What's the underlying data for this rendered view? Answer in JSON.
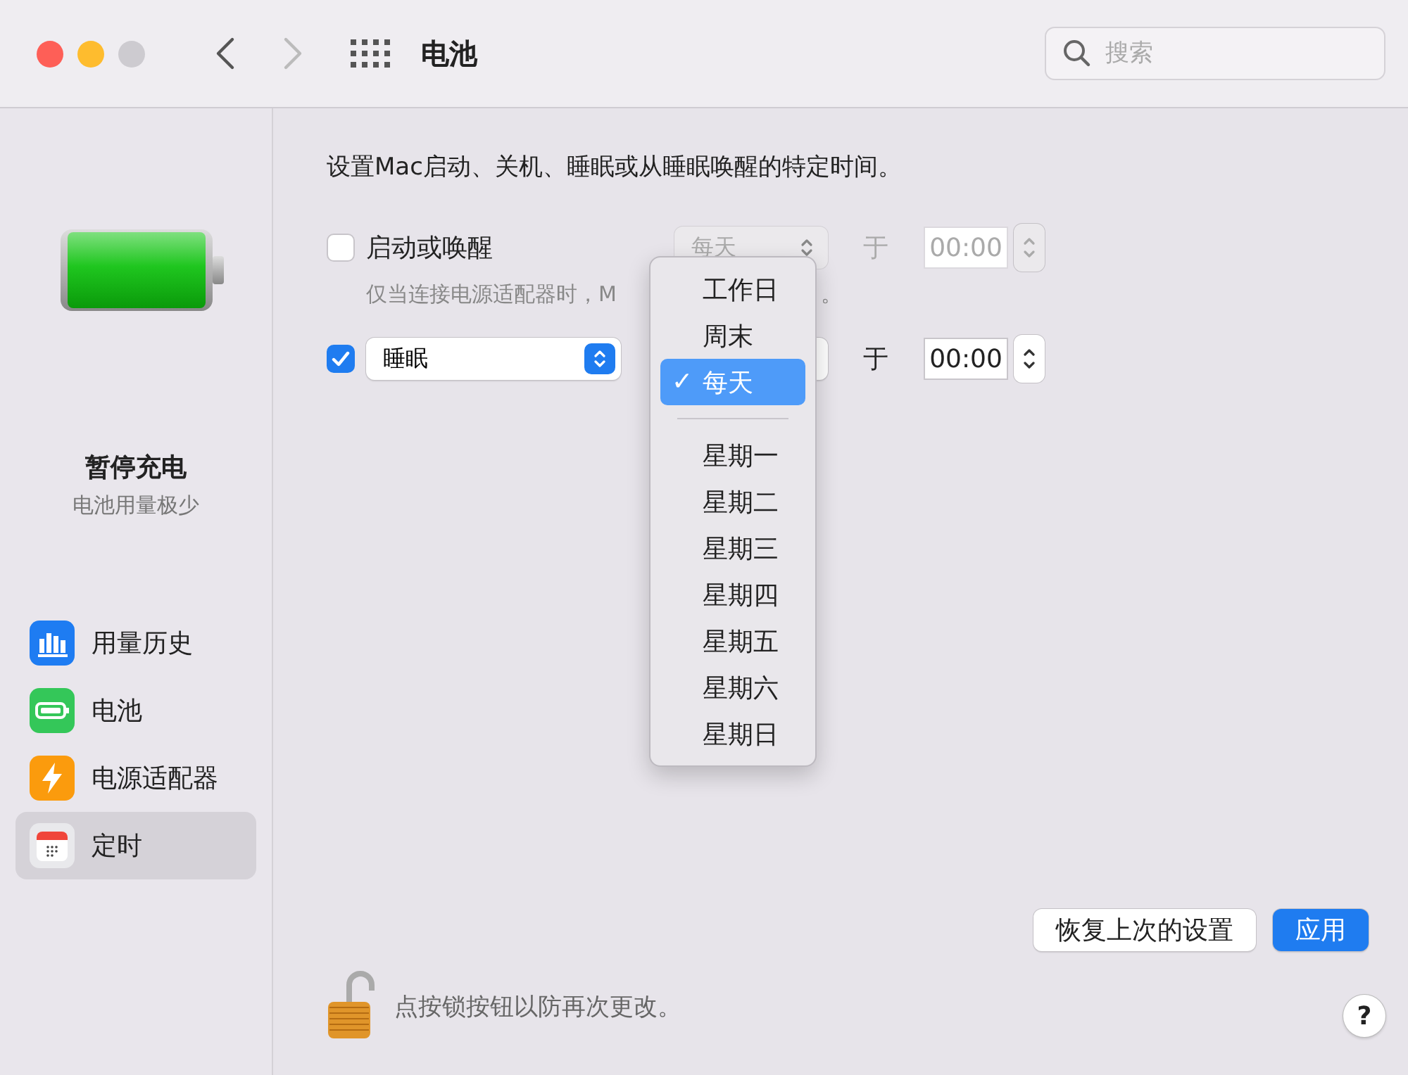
{
  "window": {
    "title": "电池",
    "traffic_lights": [
      {
        "kind": "close"
      },
      {
        "kind": "minimize"
      },
      {
        "kind": "zoom",
        "disabled": true
      }
    ],
    "back_disabled": false,
    "forward_disabled": true
  },
  "toolbar": {
    "search": {
      "placeholder": "搜索"
    }
  },
  "sidebar": {
    "status": {
      "title": "暂停充电",
      "subtitle": "电池用量极少"
    },
    "items": [
      {
        "label": "用量历史",
        "kind": "history",
        "selected": false
      },
      {
        "label": "电池",
        "kind": "battery",
        "selected": false
      },
      {
        "label": "电源适配器",
        "kind": "adapter",
        "selected": false
      },
      {
        "label": "定时",
        "kind": "schedule",
        "selected": true
      }
    ]
  },
  "schedule": {
    "intro": "设置Mac启动、关机、睡眠或从睡眠唤醒的特定时间。",
    "rows": [
      {
        "checked": false,
        "action": {
          "kind": "label",
          "text": "启动或唤醒"
        },
        "repeat": "每天",
        "at": "于",
        "time": "00:00",
        "hint": "仅当连接电源适配器时，M",
        "hint_tail": "。"
      },
      {
        "checked": true,
        "action": {
          "kind": "popup",
          "text": "睡眠"
        },
        "at": "于",
        "time": "00:00"
      }
    ]
  },
  "menu": {
    "items": [
      {
        "kind": "option",
        "label": "工作日",
        "selected": false
      },
      {
        "kind": "option",
        "label": "周末",
        "selected": false
      },
      {
        "kind": "option",
        "label": "每天",
        "selected": true,
        "check": "✓"
      },
      {
        "kind": "separator"
      },
      {
        "kind": "option",
        "label": "星期一",
        "selected": false
      },
      {
        "kind": "option",
        "label": "星期二",
        "selected": false
      },
      {
        "kind": "option",
        "label": "星期三",
        "selected": false
      },
      {
        "kind": "option",
        "label": "星期四",
        "selected": false
      },
      {
        "kind": "option",
        "label": "星期五",
        "selected": false
      },
      {
        "kind": "option",
        "label": "星期六",
        "selected": false
      },
      {
        "kind": "option",
        "label": "星期日",
        "selected": false
      }
    ]
  },
  "footer": {
    "revert_button": "恢复上次的设置",
    "apply_button": "应用",
    "lock_text": "点按锁按钮以防再次更改。",
    "help": "?"
  }
}
